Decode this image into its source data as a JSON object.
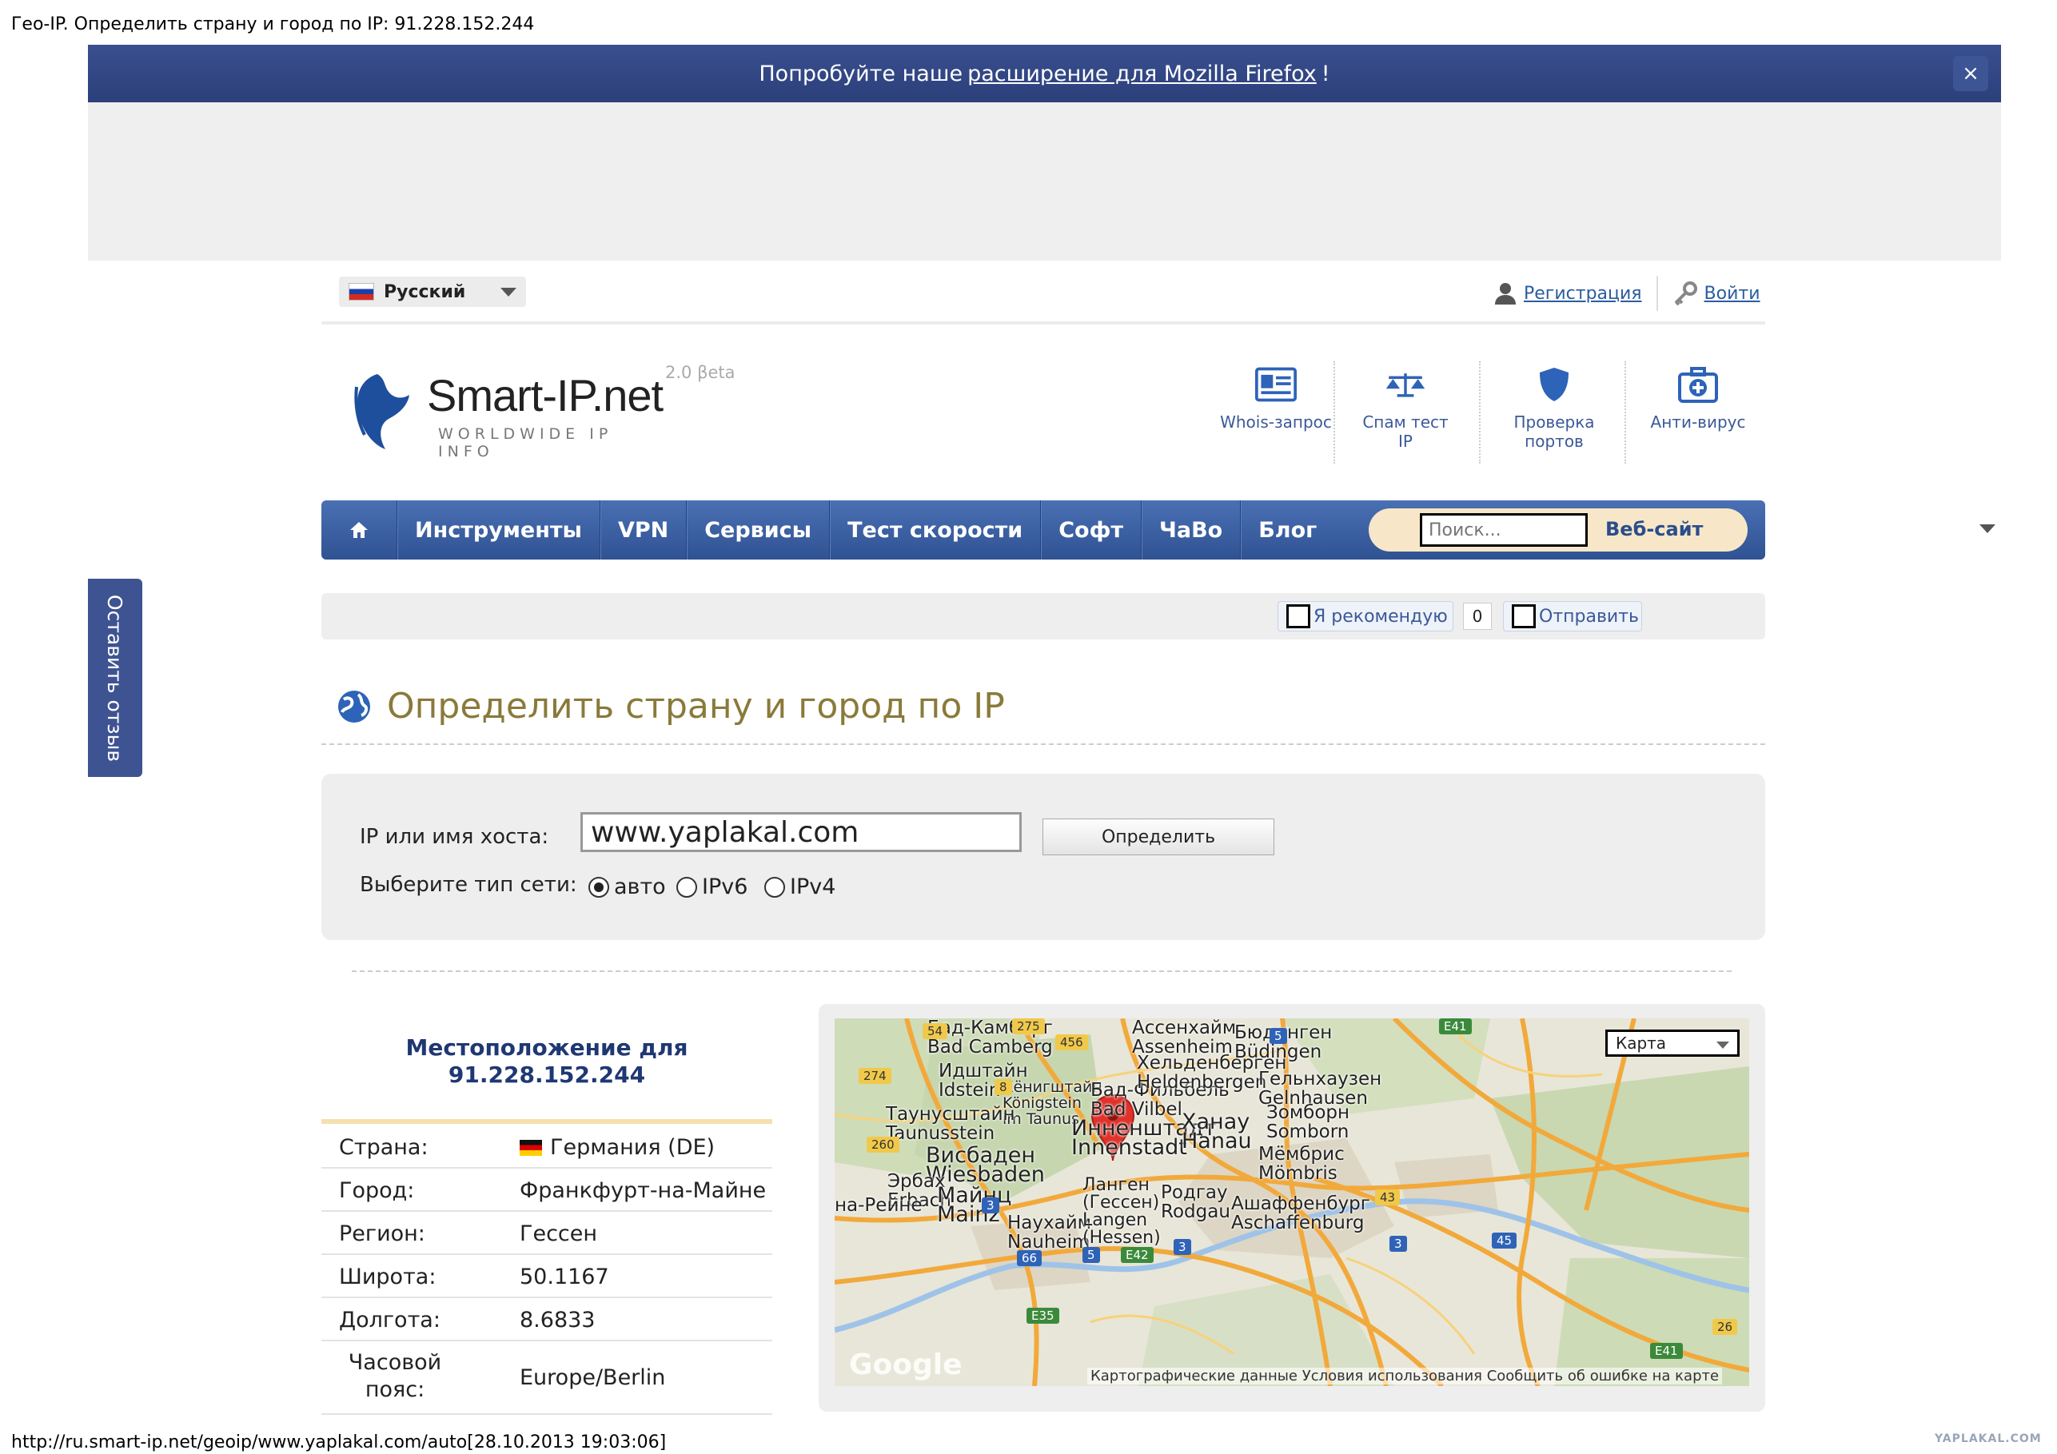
{
  "page_caption": "Гео-IP. Определить страну и город по IP: 91.228.152.244",
  "footer_url": "http://ru.smart-ip.net/geoip/www.yaplakal.com/auto[28.10.2013 19:03:06]",
  "watermark": "YAPLAKAL.COM",
  "banner": {
    "prefix": "Попробуйте наше",
    "link": "расширение для Mozilla Firefox",
    "suffix": "!",
    "close": "×"
  },
  "feedback_tab": "Оставить отзыв",
  "language": {
    "selected": "Русский"
  },
  "auth": {
    "register": "Регистрация",
    "login": "Войти"
  },
  "logo": {
    "name": "Smart-IP.net",
    "tagline": "WORLDWIDE IP INFO",
    "beta": "2.0 βeta"
  },
  "tools": [
    {
      "label": "Whois-запрос",
      "icon": "id-card-icon"
    },
    {
      "label": "Спам тест IP",
      "icon": "scales-icon"
    },
    {
      "label": "Проверка портов",
      "icon": "shield-icon"
    },
    {
      "label": "Анти-вирус",
      "icon": "medkit-icon"
    }
  ],
  "nav": {
    "home_icon": "home-icon",
    "items": [
      "Инструменты",
      "VPN",
      "Сервисы",
      "Тест скорости",
      "Софт",
      "ЧаВо",
      "Блог"
    ],
    "search_placeholder": "Поиск...",
    "search_button": "Веб-сайт"
  },
  "share": {
    "recommend": "Я рекомендую",
    "count": "0",
    "send": "Отправить"
  },
  "heading": "Определить страну и город по IP",
  "form": {
    "ip_label": "IP или имя хоста:",
    "ip_value": "www.yaplakal.com",
    "submit": "Определить",
    "nettype_label": "Выберите тип сети:",
    "options": [
      "авто",
      "IPv6",
      "IPv4"
    ],
    "selected_option": "авто"
  },
  "location": {
    "title_line1": "Местоположение для",
    "title_line2": "91.228.152.244",
    "rows": [
      {
        "key": "Страна:",
        "value": "Германия (DE)"
      },
      {
        "key": "Город:",
        "value": "Франкфурт-на-Майне"
      },
      {
        "key": "Регион:",
        "value": "Гессен"
      },
      {
        "key": "Широта:",
        "value": "50.1167"
      },
      {
        "key": "Долгота:",
        "value": "8.6833"
      },
      {
        "key": "Часовой пояс:",
        "value": "Europe/Berlin"
      }
    ]
  },
  "map": {
    "type_select": "Карта",
    "credits": "Картографические данные   Условия использования   Сообщить об ошибке на карте",
    "google": "Google",
    "labels": {
      "bad_camberg": "Бад-Камберг\nBad Camberg",
      "idstein": "Идштайн\nIdstein",
      "koenigstein": "Кёнигштайн\nKönigstein\nim Taunus",
      "taunusstein": "Таунусштайн\nTaunusstein",
      "wiesbaden": "Висбаден\nWiesbaden",
      "erbach": "Эрбах\nErbach",
      "mainz": "Майнц\nMainz",
      "nauheim": "Наухайм\nNauheim",
      "langen": "Ланген\n(Гессен)\nLangen\n(Hessen)",
      "innenstadt": "Инненштадт\nInnenstadt",
      "bad_vilbel": "Бад-Фильбель\nBad Vilbel",
      "assenheim": "Ассенхайм\nAssenheim",
      "heldenbergen": "Хельденберген\nHeldenbergen",
      "buedingen": "Бюдинген\nBüdingen",
      "gelnhausen": "Гельнхаузен\nGelnhausen",
      "hanau": "Ханау\nHanau",
      "somborn": "Зомборн\nSomborn",
      "moembris": "Мёмбрис\nMömbris",
      "rodgau": "Родгау\nRodgau",
      "aschaffenburg": "Ашаффенбург\nAschaffenburg",
      "rheine": "на-Рейне"
    },
    "shields": [
      "54",
      "275",
      "456",
      "5",
      "E41",
      "274",
      "8",
      "260",
      "3",
      "66",
      "5",
      "E42",
      "3",
      "43",
      "E35",
      "45",
      "E41",
      "26",
      "3"
    ]
  },
  "colors": {
    "banner": "#2b3f7a",
    "nav": "#2f5292",
    "heading": "#8a7a3a",
    "link": "#2a5d9f",
    "pin": "#e0322b"
  }
}
